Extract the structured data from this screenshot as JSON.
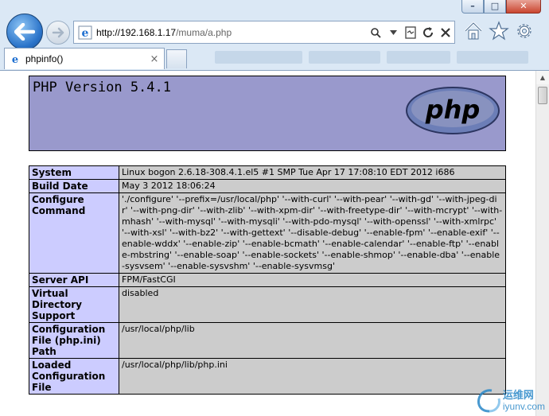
{
  "browser": {
    "address": {
      "host": "http://192.168.1.17",
      "path": "/muma/a.php"
    },
    "tab": {
      "title": "phpinfo()",
      "close": "×"
    },
    "window_buttons": {
      "minimize": "–",
      "maximize": "□",
      "close": "✕"
    }
  },
  "page": {
    "header": {
      "title": "PHP Version 5.4.1",
      "logo_text": "php"
    },
    "rows": [
      {
        "label": "System",
        "value": "Linux bogon 2.6.18-308.4.1.el5 #1 SMP Tue Apr 17 17:08:10 EDT 2012 i686"
      },
      {
        "label": "Build Date",
        "value": "May 3 2012 18:06:24"
      },
      {
        "label": "Configure Command",
        "value": "'./configure' '--prefix=/usr/local/php' '--with-curl' '--with-pear' '--with-gd' '--with-jpeg-dir' '--with-png-dir' '--with-zlib' '--with-xpm-dir' '--with-freetype-dir' '--with-mcrypt' '--with-mhash' '--with-mysql' '--with-mysqli' '--with-pdo-mysql' '--with-openssl' '--with-xmlrpc' '--with-xsl' '--with-bz2' '--with-gettext' '--disable-debug' '--enable-fpm' '--enable-exif' '--enable-wddx' '--enable-zip' '--enable-bcmath' '--enable-calendar' '--enable-ftp' '--enable-mbstring' '--enable-soap' '--enable-sockets' '--enable-shmop' '--enable-dba' '--enable-sysvsem' '--enable-sysvshm' '--enable-sysvmsg'"
      },
      {
        "label": "Server API",
        "value": "FPM/FastCGI"
      },
      {
        "label": "Virtual Directory Support",
        "value": "disabled"
      },
      {
        "label": "Configuration File (php.ini) Path",
        "value": "/usr/local/php/lib"
      },
      {
        "label": "Loaded Configuration File",
        "value": "/usr/local/php/lib/php.ini"
      }
    ]
  },
  "watermark": {
    "line1": "运维网",
    "line2": "iyunv.com"
  },
  "colors": {
    "header_bg": "#9999cc",
    "label_bg": "#ccccff",
    "value_bg": "#cccccc"
  }
}
